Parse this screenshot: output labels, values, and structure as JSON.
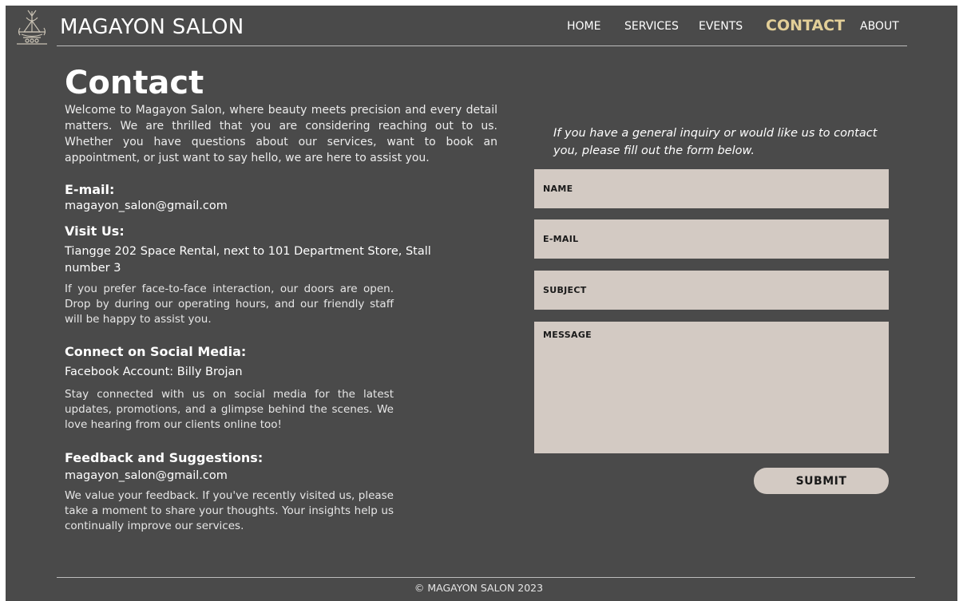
{
  "header": {
    "brand": "MAGAYON SALON",
    "nav": [
      {
        "label": "HOME"
      },
      {
        "label": "SERVICES"
      },
      {
        "label": "EVENTS"
      },
      {
        "label": "CONTACT",
        "active": true
      },
      {
        "label": "ABOUT"
      }
    ]
  },
  "main": {
    "title": "Contact",
    "intro": "Welcome to Magayon Salon, where beauty meets precision and every detail matters. We are thrilled that you are considering reaching out to us. Whether you have questions about our services, want to book an appointment, or just want to say hello, we are here to assist you.",
    "email": {
      "heading": "E-mail:",
      "value": "magayon_salon@gmail.com"
    },
    "visit": {
      "heading": "Visit Us:",
      "address": "Tiangge 202 Space Rental, next to 101 Department Store, Stall number 3",
      "text": "If you prefer face-to-face interaction, our doors are open. Drop by during our operating hours, and our friendly staff will be happy to assist you."
    },
    "social": {
      "heading": "Connect on Social Media:",
      "account": "Facebook Account: Billy Brojan",
      "text": "Stay connected with us on social media for the latest updates, promotions, and a glimpse behind the scenes. We love hearing from our clients online too!"
    },
    "feedback": {
      "heading": "Feedback and Suggestions:",
      "email": "magayon_salon@gmail.com",
      "text": "We value your feedback. If you've recently visited us, please take a moment to share your thoughts. Your insights help us continually improve our services."
    }
  },
  "form": {
    "intro": "If you have a general inquiry or would like us to contact you, please fill out the form below.",
    "name_placeholder": "NAME",
    "email_placeholder": "E-MAIL",
    "subject_placeholder": "SUBJECT",
    "message_placeholder": "MESSAGE",
    "name_value": "",
    "email_value": "",
    "subject_value": "",
    "message_value": "",
    "submit_label": "SUBMIT"
  },
  "footer": {
    "text": "© MAGAYON SALON 2023"
  },
  "colors": {
    "background": "#4a4a4a",
    "accent": "#e3cf98",
    "field": "#d3cac3"
  },
  "icons": {
    "logo": "salon-emblem-icon"
  }
}
